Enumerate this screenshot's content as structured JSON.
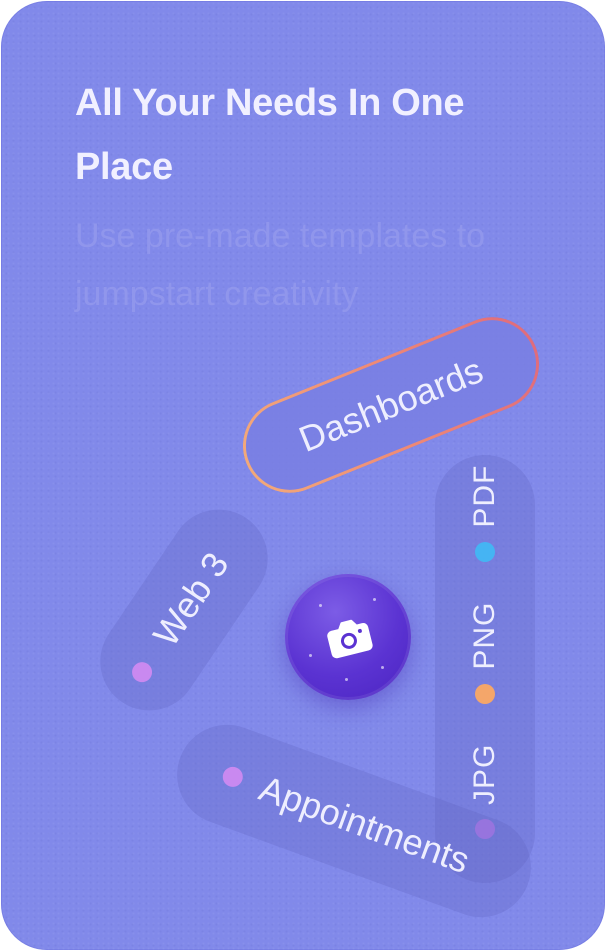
{
  "card": {
    "title": "All Your Needs In One Place",
    "subtitle": "Use pre-made templates to jumpstart creativity"
  },
  "tags": {
    "dashboards": "Dashboards",
    "web3": "Web 3",
    "appointments": "Appointments",
    "formats": [
      {
        "label": "JPG",
        "dot_color": "#b07bea"
      },
      {
        "label": "PNG",
        "dot_color": "#f4a66a"
      },
      {
        "label": "PDF",
        "dot_color": "#45b4f3"
      }
    ]
  },
  "colors": {
    "card_bg": "#8189ea",
    "accent_dot": "#c989f0",
    "badge": "#5b33d2",
    "border_gradient": [
      "#f2a97a",
      "#e06c7c"
    ]
  },
  "icons": {
    "center": "camera-icon"
  }
}
